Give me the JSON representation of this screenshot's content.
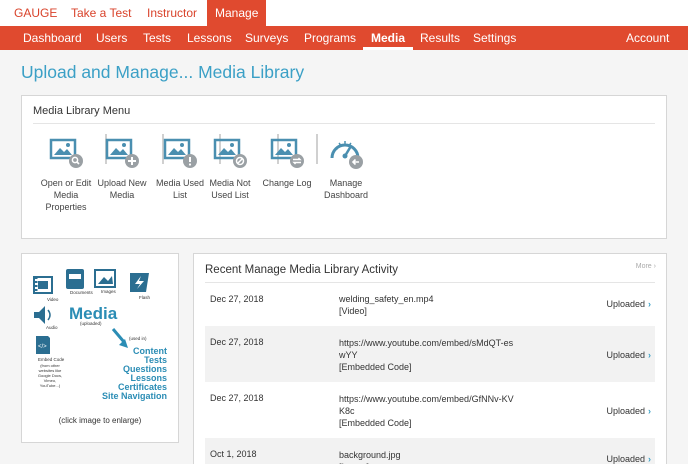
{
  "top_nav": [
    "GAUGE",
    "Take a Test",
    "Instructor",
    "Manage"
  ],
  "main_nav": [
    "Dashboard",
    "Users",
    "Tests",
    "Lessons",
    "Surveys",
    "Programs",
    "Media",
    "Results",
    "Settings"
  ],
  "account_label": "Account",
  "page_title": "Upload and Manage... Media Library",
  "menu": {
    "title": "Media Library Menu",
    "items": [
      {
        "label": "Open or Edit Media Properties",
        "icon": "media-search-icon"
      },
      {
        "label": "Upload New Media",
        "icon": "media-add-icon"
      },
      {
        "label": "Media Used List",
        "icon": "media-info-icon"
      },
      {
        "label": "Media Not Used List",
        "icon": "media-not-used-icon"
      },
      {
        "label": "Change Log",
        "icon": "media-change-icon"
      },
      {
        "label": "Manage Dashboard",
        "icon": "dashboard-gauge-icon"
      }
    ]
  },
  "media_image": {
    "labels": {
      "video": "Video",
      "documents": "Documents",
      "images": "Images",
      "flash": "Flash",
      "media": "Media",
      "uploaded": "(uploaded)",
      "audio": "Audio",
      "embed": "Embed Code",
      "embed_note": "(from other websites like Google Docs, Vimeo, YouTube...)",
      "used_in": "(used in)",
      "uses": [
        "Content",
        "Tests",
        "Questions",
        "Lessons",
        "Certificates",
        "Site Navigation"
      ]
    },
    "caption": "(click image to enlarge)"
  },
  "activity": {
    "title": "Recent Manage Media Library Activity",
    "more": "More",
    "rows": [
      {
        "date": "Dec 27, 2018",
        "name": "welding_safety_en.mp4",
        "type": "[Video]",
        "status": "Uploaded"
      },
      {
        "date": "Dec 27, 2018",
        "name": "https://www.youtube.com/embed/sMdQT-eswYY",
        "type": "[Embedded Code]",
        "status": "Uploaded"
      },
      {
        "date": "Dec 27, 2018",
        "name": "https://www.youtube.com/embed/GfNNv-KVK8c",
        "type": "[Embedded Code]",
        "status": "Uploaded"
      },
      {
        "date": "Oct 1, 2018",
        "name": "background.jpg",
        "type": "[Image]",
        "status": "Uploaded"
      }
    ]
  },
  "colors": {
    "brand": "#e04a2f",
    "accent": "#3ba0c6",
    "icon": "#4a8fb0",
    "icon_badge": "#9aa0a4"
  }
}
